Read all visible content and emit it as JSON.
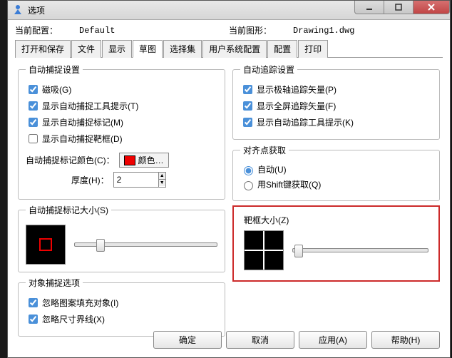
{
  "window": {
    "title": "选项"
  },
  "info": {
    "current_config_label": "当前配置：",
    "current_config_value": "Default",
    "current_drawing_label": "当前图形：",
    "current_drawing_value": "Drawing1.dwg"
  },
  "tabs": [
    "打开和保存",
    "文件",
    "显示",
    "草图",
    "选择集",
    "用户系统配置",
    "配置",
    "打印"
  ],
  "active_tab_index": 3,
  "autosnap": {
    "group_label": "自动捕捉设置",
    "magnet": "磁吸(G)",
    "show_tooltip": "显示自动捕捉工具提示(T)",
    "show_marker": "显示自动捕捉标记(M)",
    "show_aperture": "显示自动捕捉靶框(D)",
    "color_label": "自动捕捉标记颜色(C)：",
    "color_btn": "颜色…",
    "thickness_label": "厚度(H)：",
    "thickness_value": "2"
  },
  "marker_size": {
    "group_label": "自动捕捉标记大小(S)"
  },
  "object_snap_opts": {
    "group_label": "对象捕捉选项",
    "ignore_hatch": "忽略图案填充对象(I)",
    "ignore_dim": "忽略尺寸界线(X)"
  },
  "autotrack": {
    "group_label": "自动追踪设置",
    "polar_vector": "显示极轴追踪矢量(P)",
    "fullscreen_vector": "显示全屏追踪矢量(F)",
    "tooltip": "显示自动追踪工具提示(K)"
  },
  "alignment": {
    "group_label": "对齐点获取",
    "auto": "自动(U)",
    "shift": "用Shift键获取(Q)"
  },
  "aperture_size": {
    "group_label": "靶框大小(Z)"
  },
  "buttons": {
    "ok": "确定",
    "cancel": "取消",
    "apply": "应用(A)",
    "help": "帮助(H)"
  }
}
